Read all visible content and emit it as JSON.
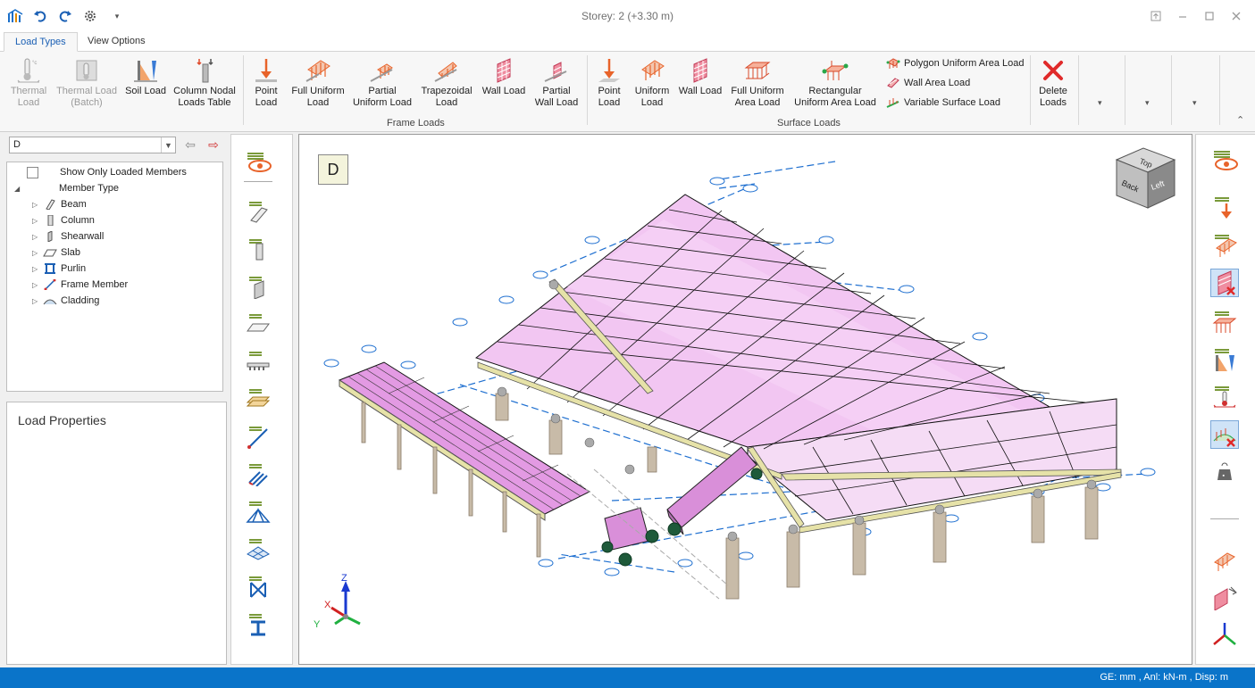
{
  "window": {
    "title": "Storey: 2 (+3.30 m)",
    "controls": [
      "pin-icon",
      "minimize-icon",
      "maximize-icon",
      "close-icon"
    ]
  },
  "quick_access": [
    "app-logo-icon",
    "undo-icon",
    "redo-icon",
    "settings-gear-icon",
    "customize-chevron-icon"
  ],
  "tabs": [
    {
      "label": "Load Types",
      "active": true
    },
    {
      "label": "View Options",
      "active": false
    }
  ],
  "ribbon": {
    "general": {
      "thermal_load": "Thermal\nLoad",
      "thermal_load_batch": "Thermal Load\n(Batch)",
      "soil_load": "Soil Load",
      "column_nodal": "Column Nodal\nLoads Table"
    },
    "frame_loads": {
      "group_label": "Frame Loads",
      "point_load": "Point\nLoad",
      "full_uniform_load": "Full Uniform\nLoad",
      "partial_uniform_load": "Partial\nUniform Load",
      "trapezoidal_load": "Trapezoidal\nLoad",
      "wall_load": "Wall Load",
      "partial_wall_load": "Partial\nWall Load"
    },
    "surface_loads": {
      "group_label": "Surface Loads",
      "point_load": "Point\nLoad",
      "uniform_load": "Uniform\nLoad",
      "wall_load": "Wall Load",
      "full_uniform_area_load": "Full Uniform\nArea Load",
      "rectangular_uniform_area_load": "Rectangular\nUniform Area Load",
      "polygon_uniform_area_load": "Polygon Uniform Area Load",
      "wall_area_load": "Wall Area Load",
      "variable_surface_load": "Variable Surface Load"
    },
    "delete_loads": "Delete\nLoads",
    "dropdown_glyph": "▾",
    "collapse_glyph": "⌃"
  },
  "left_panel": {
    "storey_combo_value": "D",
    "tree": {
      "show_only_loaded": "Show Only Loaded Members",
      "show_only_loaded_checked": false,
      "member_type": "Member Type",
      "items": [
        {
          "label": "Beam",
          "icon": "beam-icon"
        },
        {
          "label": "Column",
          "icon": "column-icon"
        },
        {
          "label": "Shearwall",
          "icon": "shearwall-icon"
        },
        {
          "label": "Slab",
          "icon": "slab-icon"
        },
        {
          "label": "Purlin",
          "icon": "purlin-icon"
        },
        {
          "label": "Frame Member",
          "icon": "frame-member-icon"
        },
        {
          "label": "Cladding",
          "icon": "cladding-icon"
        }
      ]
    },
    "load_properties_title": "Load Properties"
  },
  "viewport": {
    "storey_label": "D",
    "view_cube": {
      "top": "Top",
      "back": "Back",
      "left": "Left"
    },
    "axis": {
      "z": "Z",
      "x": "X",
      "y": "Y"
    },
    "colors": {
      "load_pink": "#e8a6e8",
      "beam_yellow": "#e6e2a8",
      "column_tan": "#c8bba8",
      "grid_blue": "#1e6fd0"
    }
  },
  "status_bar": {
    "units": "GE: mm , Anl: kN-m , Disp: m"
  }
}
